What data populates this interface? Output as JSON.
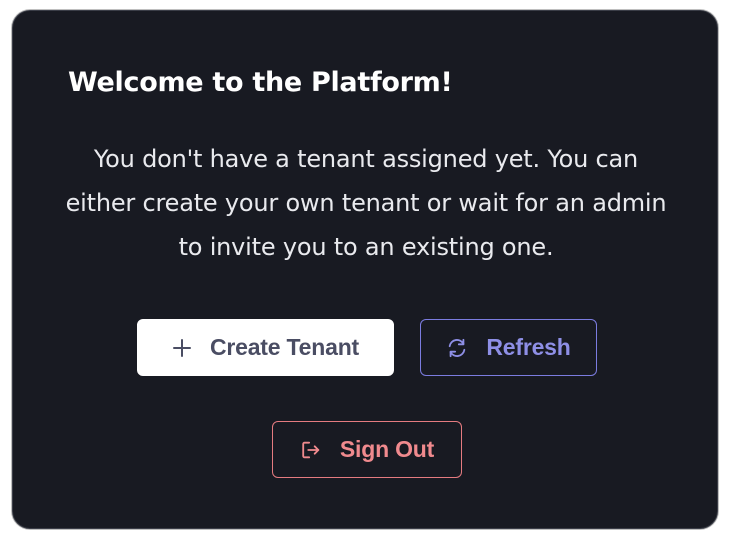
{
  "card": {
    "title": "Welcome to the Platform!",
    "message": "You don't have a tenant assigned yet. You can either create your own tenant or wait for an admin to invite you to an existing one."
  },
  "actions": {
    "create_tenant": {
      "label": "Create Tenant",
      "icon": "plus-icon"
    },
    "refresh": {
      "label": "Refresh",
      "icon": "refresh-icon"
    },
    "sign_out": {
      "label": "Sign Out",
      "icon": "sign-out-icon"
    }
  },
  "colors": {
    "card_background": "#181a22",
    "primary_text": "#ffffff",
    "refresh_accent": "#7b7ce0",
    "sign_out_accent": "#e57b80"
  }
}
